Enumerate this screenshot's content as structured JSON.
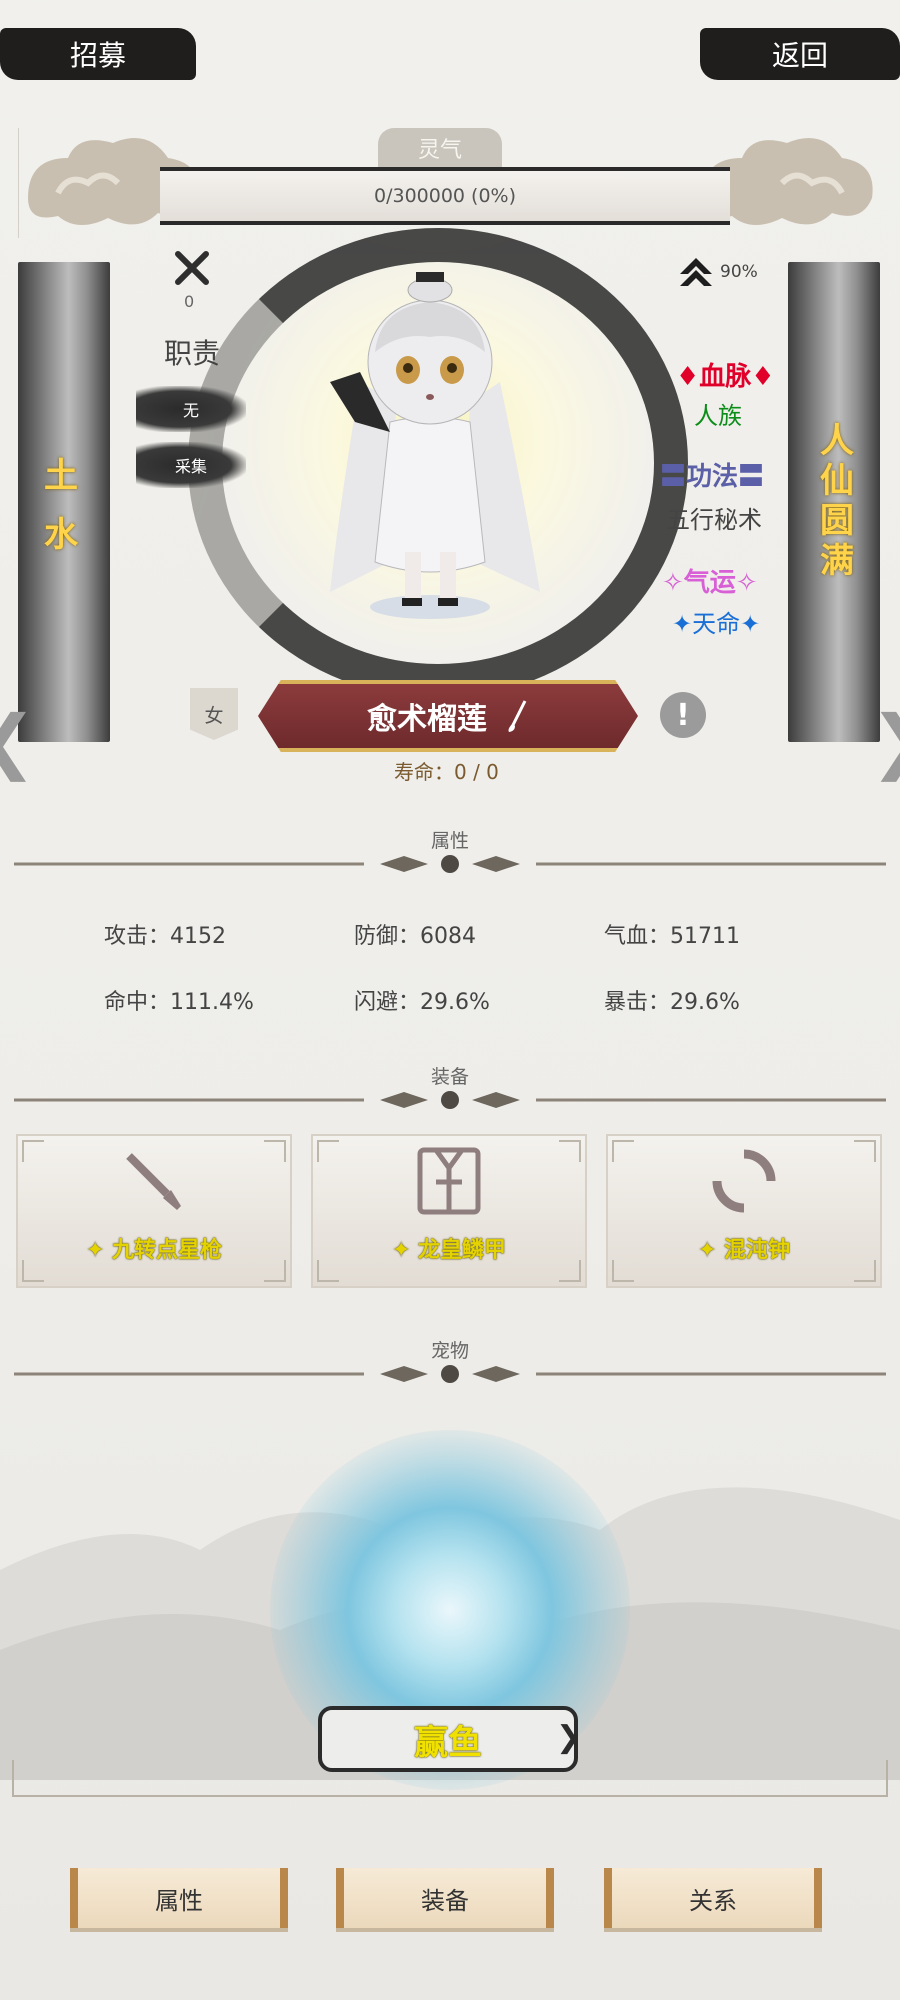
{
  "header": {
    "recruit_label": "招募",
    "back_label": "返回"
  },
  "qi": {
    "title": "灵气",
    "progress_text": "0/300000 (0%)",
    "progress_fraction": 0
  },
  "left_info": {
    "weapon_count": "0",
    "duty_label": "职责",
    "tags": [
      "无",
      "采集"
    ]
  },
  "left_pillar": {
    "elements": [
      "土",
      "水"
    ]
  },
  "right_pillar": {
    "realm": "人仙圆满"
  },
  "right_info": {
    "rank_value": "90%",
    "bloodline_title": "♦血脉♦",
    "bloodline_value": "人族",
    "method_title": "〓功法〓",
    "method_value": "五行秘术",
    "luck_title": "✧气运✧",
    "luck_value": "✦天命✦"
  },
  "character": {
    "gender": "女",
    "name": "愈术榴莲",
    "lifespan": "寿命：0 / 0",
    "alert": "!"
  },
  "sections": {
    "attributes": "属性",
    "equipment": "装备",
    "pet": "宠物"
  },
  "stats": [
    {
      "label": "攻击：4152"
    },
    {
      "label": "防御：6084"
    },
    {
      "label": "气血：51711"
    },
    {
      "label": "命中：111.4%"
    },
    {
      "label": "闪避：29.6%"
    },
    {
      "label": "暴击：29.6%"
    }
  ],
  "equipment": [
    {
      "name": "✦ 九转点星枪",
      "icon": "spear-icon"
    },
    {
      "name": "✦ 龙皇鳞甲",
      "icon": "armor-icon"
    },
    {
      "name": "✦ 混沌钟",
      "icon": "bell-ring-icon"
    }
  ],
  "pet": {
    "name": "赢鱼"
  },
  "tabs": {
    "attr": "属性",
    "equip": "装备",
    "relation": "关系"
  },
  "colors": {
    "bloodline": "#e0002a",
    "race": "#0c8d1a",
    "method": "#5a5fa8",
    "luck": "#d85fd5",
    "destiny": "#1a6fd6",
    "gold_text": "#e4d300",
    "banner": "#7a3133"
  }
}
